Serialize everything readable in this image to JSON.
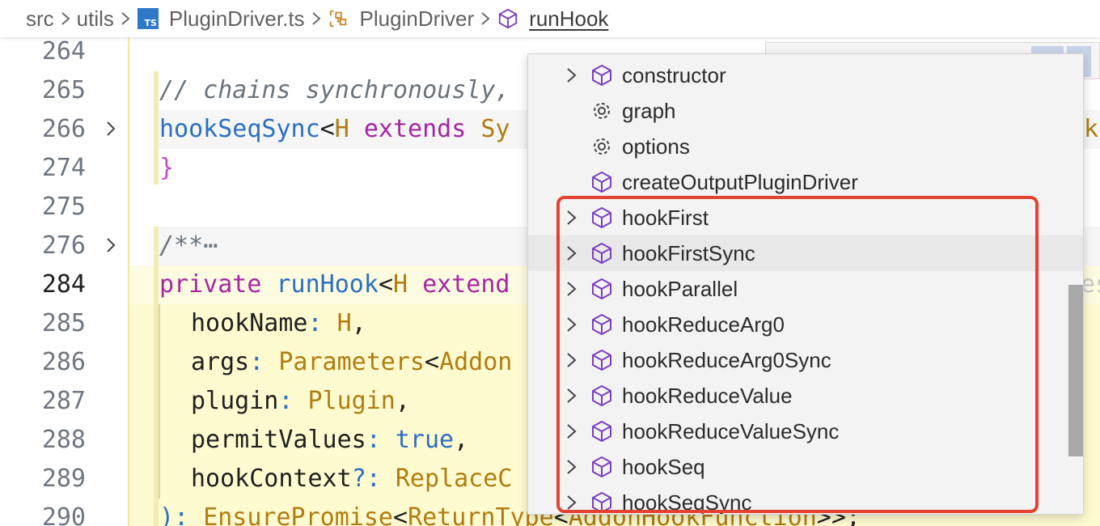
{
  "breadcrumb": {
    "items": [
      "src",
      "utils",
      "PluginDriver.ts",
      "PluginDriver",
      "runHook"
    ],
    "ts_badge": "TS"
  },
  "editor": {
    "lines": [
      {
        "num": "264"
      },
      {
        "num": "265",
        "comment": "// chains synchronously,"
      },
      {
        "num": "266",
        "fn": "hookSeqSync",
        "lt": "<",
        "type_param": "H",
        "kw": "extends",
        "type": "Sy",
        "tail": "ks"
      },
      {
        "num": "274",
        "brace": "}"
      },
      {
        "num": "275"
      },
      {
        "num": "276",
        "comment": "/**",
        "ellipsis": "⋯"
      },
      {
        "num": "284",
        "kw": "private",
        "fn": "runHook",
        "lt": "<",
        "type_param": "H",
        "kw2": "extend",
        "tail": "es"
      },
      {
        "num": "285",
        "name": "hookName",
        "colon": ":",
        "type": "H",
        "punct": ","
      },
      {
        "num": "286",
        "name": "args",
        "colon": ":",
        "type": "Parameters",
        "lt": "<",
        "type2": "Addon"
      },
      {
        "num": "287",
        "name": "plugin",
        "colon": ":",
        "type": "Plugin",
        "punct": ","
      },
      {
        "num": "288",
        "name": "permitValues",
        "colon": ":",
        "bool": "true",
        "punct": ","
      },
      {
        "num": "289",
        "name": "hookContext",
        "colon": "?:",
        "type": "ReplaceC"
      },
      {
        "num": "290",
        "close": ")",
        "colon": ":",
        "type": "EnsurePromise",
        "lt": "<",
        "type2": "ReturnType",
        "lt2": "<",
        "type3": "AddonHookFunction",
        "end": ">>;"
      }
    ]
  },
  "dropdown": {
    "items": [
      {
        "label": "constructor",
        "icon": "method-cube-icon",
        "expandable": true
      },
      {
        "label": "graph",
        "icon": "gear-icon",
        "expandable": false
      },
      {
        "label": "options",
        "icon": "gear-icon",
        "expandable": false
      },
      {
        "label": "createOutputPluginDriver",
        "icon": "method-cube-icon",
        "expandable": false
      },
      {
        "label": "hookFirst",
        "icon": "method-cube-icon",
        "expandable": true
      },
      {
        "label": "hookFirstSync",
        "icon": "method-cube-icon",
        "expandable": true
      },
      {
        "label": "hookParallel",
        "icon": "method-cube-icon",
        "expandable": true
      },
      {
        "label": "hookReduceArg0",
        "icon": "method-cube-icon",
        "expandable": true
      },
      {
        "label": "hookReduceArg0Sync",
        "icon": "method-cube-icon",
        "expandable": true
      },
      {
        "label": "hookReduceValue",
        "icon": "method-cube-icon",
        "expandable": true
      },
      {
        "label": "hookReduceValueSync",
        "icon": "method-cube-icon",
        "expandable": true
      },
      {
        "label": "hookSeq",
        "icon": "method-cube-icon",
        "expandable": true
      },
      {
        "label": "hookSeqSync",
        "icon": "method-cube-icon",
        "expandable": true
      }
    ]
  },
  "colors": {
    "method_icon": "#7a3fc0",
    "annotation_box": "#e5412f",
    "ts_badge": "#2d79c7"
  }
}
